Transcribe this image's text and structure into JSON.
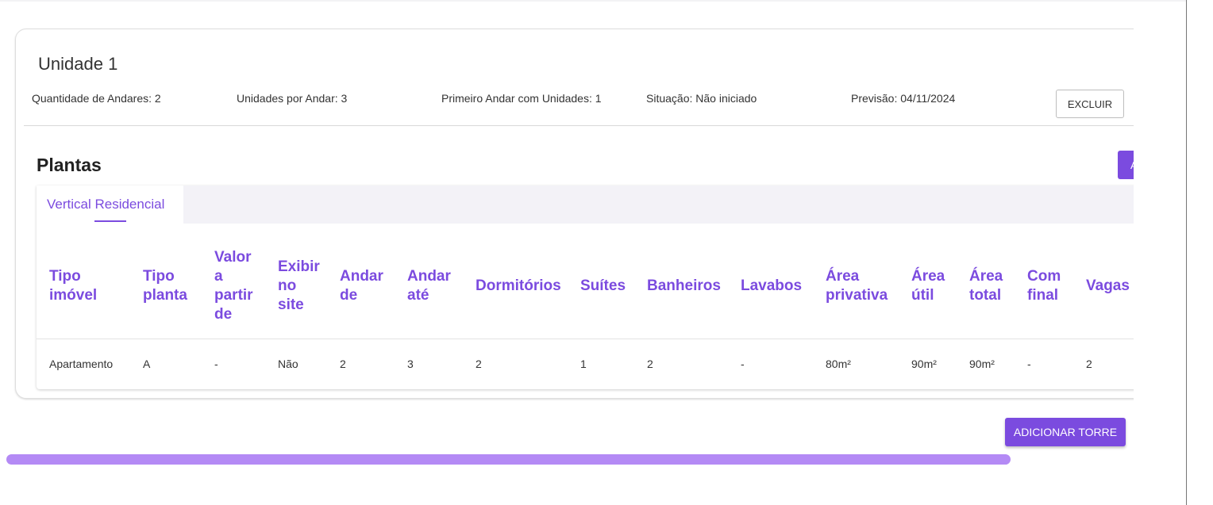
{
  "unit": {
    "title": "Unidade 1",
    "info": [
      {
        "label": "Quantidade de Andares:",
        "value": "2"
      },
      {
        "label": "Unidades por Andar:",
        "value": "3"
      },
      {
        "label": "Primeiro Andar com Unidades:",
        "value": "1"
      },
      {
        "label": "Situação:",
        "value": "Não iniciado"
      },
      {
        "label": "Previsão:",
        "value": "04/11/2024"
      }
    ],
    "excluir_label": "EXCLUIR"
  },
  "plantas": {
    "title": "Plantas",
    "add_button_label": "A",
    "tabs": [
      {
        "label": "Vertical Residencial",
        "active": true
      }
    ],
    "columns": [
      [
        "Tipo",
        "imóvel"
      ],
      [
        "Tipo",
        "planta"
      ],
      [
        "Valor",
        "a",
        "partir",
        "de"
      ],
      [
        "Exibir",
        "no",
        "site"
      ],
      [
        "Andar",
        "de"
      ],
      [
        "Andar",
        "até"
      ],
      [
        "Dormitórios"
      ],
      [
        "Suítes"
      ],
      [
        "Banheiros"
      ],
      [
        "Lavabos"
      ],
      [
        "Área",
        "privativa"
      ],
      [
        "Área",
        "útil"
      ],
      [
        "Área",
        "total"
      ],
      [
        "Com",
        "final"
      ],
      [
        "Vagas"
      ]
    ],
    "rows": [
      [
        "Apartamento",
        "A",
        "-",
        "Não",
        "2",
        "3",
        "2",
        "1",
        "2",
        "-",
        "80m²",
        "90m²",
        "90m²",
        "-",
        "2"
      ]
    ]
  },
  "add_torre_label": "ADICIONAR TORRE",
  "colors": {
    "accent": "#7b4bdf",
    "scrollbar": "#b48af5"
  }
}
